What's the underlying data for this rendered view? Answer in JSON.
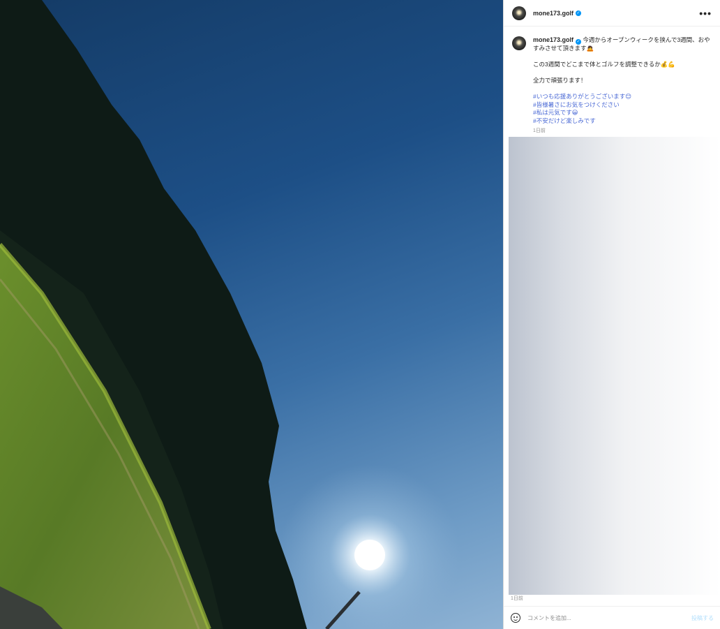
{
  "post": {
    "username": "mone173.golf",
    "verified_icon": "verified-badge-icon",
    "more_icon": "more-options-icon",
    "more_label": "•••"
  },
  "caption": {
    "username": "mone173.golf",
    "line1": " 今週からオープンウィークを挟んで3週間、おや",
    "line2": "すみさせて頂きます🙇",
    "line3": "この3週間でどこまで体とゴルフを調整できるか💰💪",
    "line4": "全力で頑張ります！",
    "hashtags": [
      "#いつも応援ありがとうございます😊",
      "#皆様暑さにお気をつけください",
      "#私は元気です😀",
      "#不安だけど楽しみです"
    ],
    "time": "1日前"
  },
  "footer": {
    "time": "1日前",
    "comment_placeholder": "コメントを追加...",
    "post_label": "投稿する",
    "emoji_icon": "emoji-smile-icon"
  },
  "colors": {
    "verified": "#0095f6",
    "hashtag": "#4a69d5",
    "post_button_disabled": "#b2dffc"
  }
}
